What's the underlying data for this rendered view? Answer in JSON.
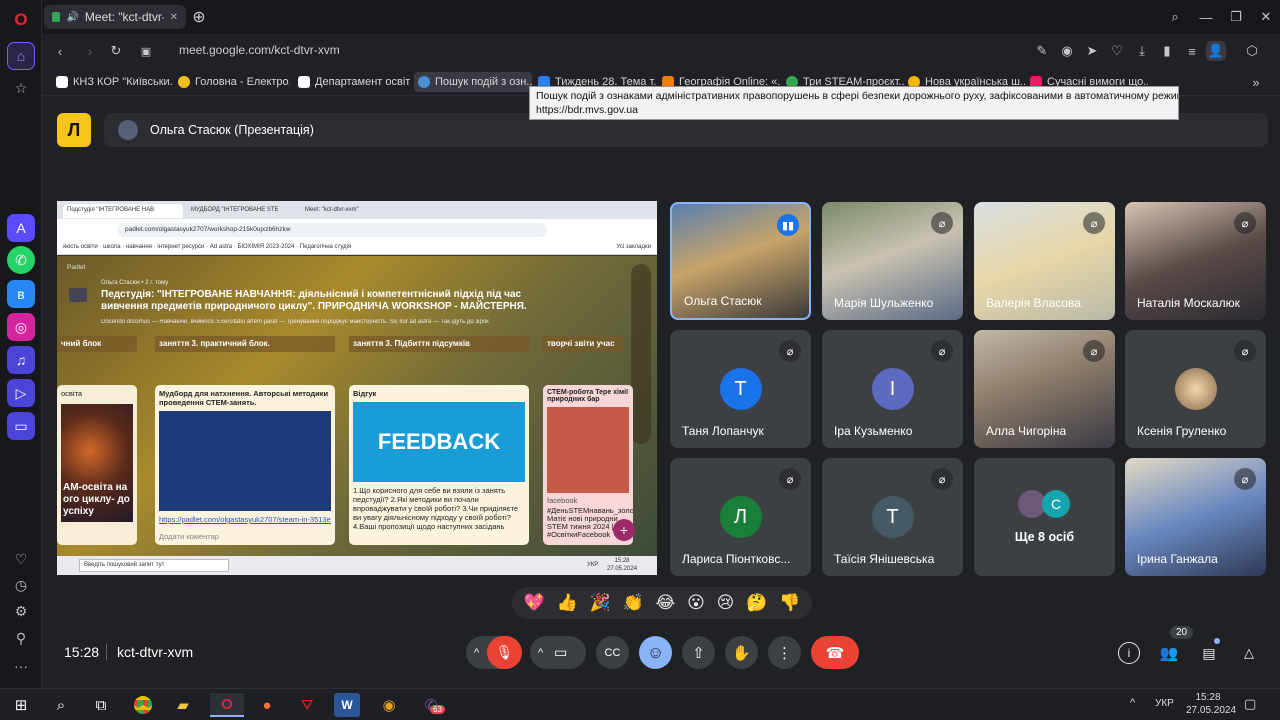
{
  "browser": {
    "tab_title": "Meet: \"kct-dtvr-xv",
    "url": "meet.google.com/kct-dtvr-xvm",
    "bookmarks": [
      {
        "label": "КНЗ КОР \"Київськи...",
        "color": "#ffffff"
      },
      {
        "label": "Головна - Електро...",
        "color": "#f0c020"
      },
      {
        "label": "Департамент освіт...",
        "color": "#ffffff"
      },
      {
        "label": "Пошук подій з озн...",
        "color": "#4a90d9"
      },
      {
        "label": "Тиждень 28. Тема т...",
        "color": "#2f80ed"
      },
      {
        "label": "Географія Online: «...",
        "color": "#f57c00"
      },
      {
        "label": "Три STEAM-проєкт...",
        "color": "#34a853"
      },
      {
        "label": "Нова українська ш...",
        "color": "#f4b400"
      },
      {
        "label": "Сучасні вимоги що...",
        "color": "#e91e63"
      }
    ],
    "tooltip_title": "Пошук подій з ознаками адміністративних правопорушень в сфері безпеки дорожнього руху, зафіксованими в автоматичному режимі...",
    "tooltip_url": "https://bdr.mvs.gov.ua"
  },
  "meet": {
    "presenter_label": "Ольга Стасюк (Презентація)",
    "logo_letter": "Л",
    "time": "15:28",
    "meeting_code": "kct-dtvr-xvm",
    "participants_count": "20",
    "more_others": "Ще 8 осіб",
    "more_avatar_letter": "С",
    "participants": [
      {
        "name": "Ольга Стасюк",
        "type": "video",
        "speaking": true
      },
      {
        "name": "Марія Шульженко",
        "type": "video",
        "muted": true
      },
      {
        "name": "Валерія Власова",
        "type": "video",
        "muted": true
      },
      {
        "name": "Наталія Москалюк",
        "type": "video",
        "muted": true
      },
      {
        "name": "Таня Лопанчук",
        "type": "avatar",
        "letter": "T",
        "color": "#1a73e8",
        "muted": true
      },
      {
        "name": "Іра Кузьменко",
        "type": "avatar",
        "letter": "І",
        "color": "#5c6bc0",
        "muted": true
      },
      {
        "name": "Алла Чигоріна",
        "type": "video",
        "muted": true
      },
      {
        "name": "Ксенія Груленко",
        "type": "photo",
        "muted": true
      },
      {
        "name": "Лариса Піонтковс...",
        "type": "avatar",
        "letter": "Л",
        "color": "#188038",
        "muted": true
      },
      {
        "name": "Таїсія Янішевська",
        "type": "avatar",
        "letter": "T",
        "color": "#455a64",
        "muted": true
      },
      {
        "name": "Ірина Ганжала",
        "type": "video",
        "muted": true
      }
    ],
    "reactions": [
      "💖",
      "👍",
      "🎉",
      "👏",
      "😂",
      "😮",
      "😢",
      "🤔",
      "👎"
    ]
  },
  "presentation": {
    "tabs": [
      "Подстудія \"ІНТЕГРОВАНЕ НАВ",
      "МУДБОРД \"ІНТЕГРОВАНЕ STE",
      "Meet: \"kct-dtvr-xvm\""
    ],
    "url": "padlet.com/olgastasyuk2707/workshop-215k0ujxzb6hzkw",
    "bookmarks": [
      "якість освіти",
      "школа",
      "навчання",
      "інтернет ресурси",
      "Ad astra",
      "БІОХІМІЯ 2023-2024",
      "Педагогічна студія"
    ],
    "all_bookmarks": "Усі закладки",
    "padlet_brand": "Padlet",
    "author_line": "Ольга Стасюк • 2 г. тому",
    "title": "Педстудія: \"ІНТЕГРОВАНЕ НАВЧАННЯ: діяльнісний і компетентнісний підхід під час вивчення предметів природничого циклу\". ПРИРОДНИЧА WORKSHOP - МАЙСТЕРНЯ.",
    "subtitle": "Docendo discimus — Навчаючи, вчимося. Exercitatio artem parat — Тренування породжує майстерність. Sic itur ad astra — Так ідуть до зірок",
    "columns": [
      "чний блок",
      "заняття 3. практичний блок.",
      "заняття 3. Підбиття підсумків",
      "творчі звіти учас"
    ],
    "card1_text": "AM-освіта на ого циклу- до успіху",
    "card1_top": "освіта",
    "card2_title": "Мудборд для натхнення. Авторські методики проведення СТЕМ-занять.",
    "card2_link": "https://padlet.com/olgastasyuk2707/steam-in-3513eq25",
    "card2_comment": "Додати коментар",
    "card3_title": "Відгук",
    "card3_art": "FEEDBACK",
    "card3_text": "1.Що корисного для себе ви взяли із занять педстудії? 2.Які методики ви почали впроваджувати у своїй роботі? 3.Чи приділяєте ви увагу діяльнісному підходу у своїй роботі? 4.Ваші пропозиції щодо наступних засідань",
    "card4_title": "СТЕМ-робота Тере хімії природних бар",
    "card4_tag": "facebook",
    "card4_text": "#ДеньSTEMнавань_золо Матіє нові природни STEM тижня 2024 | Вс #ОсвіткиFacebook",
    "taskbar_search": "Введіть пошуковий запит тут",
    "taskbar_lang": "УКР",
    "taskbar_time": "15:28",
    "taskbar_date": "27.05.2024"
  },
  "taskbar": {
    "lang": "УКР",
    "time": "15:28",
    "date": "27.05.2024",
    "viber_badge": "63"
  }
}
